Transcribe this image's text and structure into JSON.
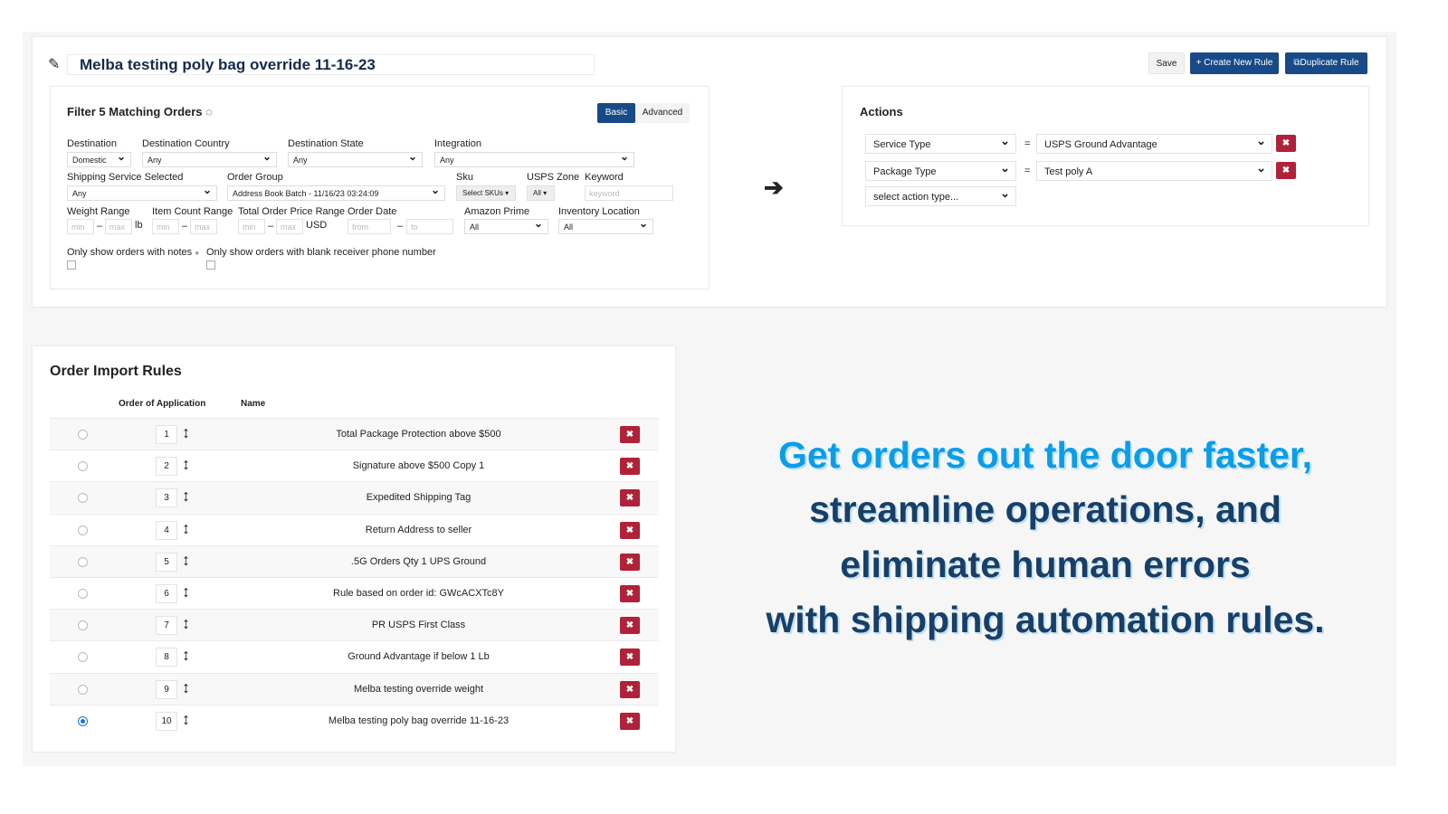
{
  "rule": {
    "title": "Melba testing poly bag override 11-16-23",
    "save": "Save",
    "create": "Create New Rule",
    "duplicate": "Duplicate Rule"
  },
  "filter": {
    "heading": "Filter 5 Matching Orders",
    "tab_basic": "Basic",
    "tab_advanced": "Advanced",
    "destination": {
      "label": "Destination",
      "value": "Domestic"
    },
    "country": {
      "label": "Destination Country",
      "value": "Any"
    },
    "state": {
      "label": "Destination State",
      "value": "Any"
    },
    "integration": {
      "label": "Integration",
      "value": "Any"
    },
    "shipping": {
      "label": "Shipping Service Selected",
      "value": "Any"
    },
    "order_group": {
      "label": "Order Group",
      "value": "Address Book Batch - 11/16/23 03:24:09"
    },
    "sku": {
      "label": "Sku",
      "value": "Select SKUs ▾"
    },
    "zone": {
      "label": "USPS Zone",
      "value": "All ▾"
    },
    "keyword": {
      "label": "Keyword",
      "placeholder": "keyword"
    },
    "weight": {
      "label": "Weight Range",
      "min": "min",
      "max": "max",
      "unit": "lb"
    },
    "item_count": {
      "label": "Item Count Range",
      "min": "min",
      "max": "max"
    },
    "price": {
      "label": "Total Order Price Range",
      "min": "min",
      "max": "max",
      "unit": "USD"
    },
    "date": {
      "label": "Order Date",
      "from": "from",
      "to": "to"
    },
    "prime": {
      "label": "Amazon Prime",
      "value": "All"
    },
    "inventory": {
      "label": "Inventory Location",
      "value": "All"
    },
    "notes_label": "Only show orders with notes",
    "blank_phone_label": "Only show orders with blank receiver phone number",
    "dash": "–"
  },
  "actions": {
    "heading": "Actions",
    "eq": "=",
    "rows": [
      {
        "type": "Service Type",
        "value": "USPS Ground Advantage"
      },
      {
        "type": "Package Type",
        "value": "Test poly A"
      }
    ],
    "new_placeholder": "select action type..."
  },
  "rules": {
    "heading": "Order Import Rules",
    "col_order": "Order of Application",
    "col_name": "Name",
    "selected": 10,
    "items": [
      "Total Package Protection above $500",
      "Signature above $500 Copy 1",
      "Expedited Shipping Tag",
      "Return Address to seller",
      ".5G Orders Qty 1 UPS Ground",
      "Rule based on order id: GWcACXTc8Y",
      "PR USPS First Class",
      "Ground Advantage if below 1 Lb",
      "Melba testing override weight",
      "Melba testing poly bag override 11-16-23"
    ]
  },
  "promo": {
    "line1": "Get orders out the door faster,",
    "line2": "streamline operations, and",
    "line3": "eliminate human errors",
    "line4": "with shipping automation rules.",
    "color_accent": "#0a9de8",
    "color_main": "#173f68"
  }
}
